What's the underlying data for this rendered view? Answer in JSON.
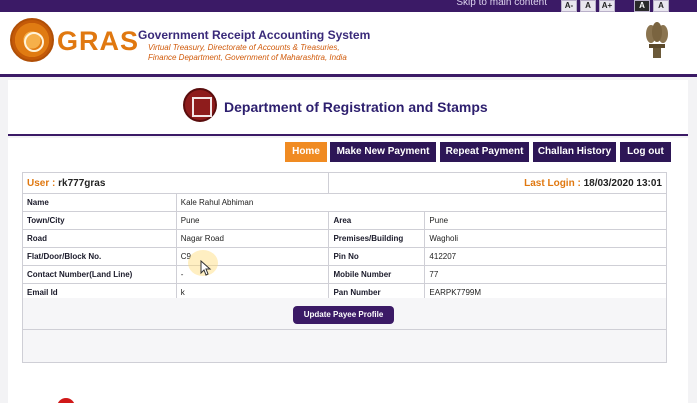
{
  "topbar": {
    "skip_link": "Skip to main content",
    "font_small": "A-",
    "font_normal": "A",
    "font_large": "A+",
    "contrast_dark": "A",
    "contrast_light": "A"
  },
  "header": {
    "logo_text": "GRAS",
    "system_title": "Government Receipt Accounting System",
    "subtitle_line1": "Virtual Treasury, Directorate of Accounts & Treasuries,",
    "subtitle_line2": "Finance Department, Government of Maharashtra, India"
  },
  "department": {
    "title": "Department of Registration and Stamps"
  },
  "nav": {
    "items": [
      {
        "label": "Home",
        "active": true
      },
      {
        "label": "Make New Payment"
      },
      {
        "label": "Repeat Payment"
      },
      {
        "label": "Challan History"
      },
      {
        "label": "Log out"
      }
    ]
  },
  "profile": {
    "user_label": "User :",
    "user_value": "rk777gras",
    "last_login_label": "Last Login :",
    "last_login_value": "18/03/2020 13:01",
    "rows": [
      {
        "label": "Name",
        "value": "Kale Rahul Abhiman"
      },
      {
        "label": "Town/City",
        "value": "Pune",
        "label2": "Area",
        "value2": "Pune"
      },
      {
        "label": "Road",
        "value": "Nagar Road",
        "label2": "Premises/Building",
        "value2": "Wagholi"
      },
      {
        "label": "Flat/Door/Block No.",
        "value": "C9",
        "label2": "Pin No",
        "value2": "412207"
      },
      {
        "label": "Contact Number(Land Line)",
        "value": "-",
        "label2": "Mobile Number",
        "value2": "77"
      },
      {
        "label": "Email Id",
        "value": "k",
        "label2": "Pan Number",
        "value2": "EARPK7799M"
      }
    ],
    "update_button": "Update Payee Profile"
  },
  "colors": {
    "brand_purple": "#3b1a66",
    "accent_orange": "#f08b22"
  }
}
